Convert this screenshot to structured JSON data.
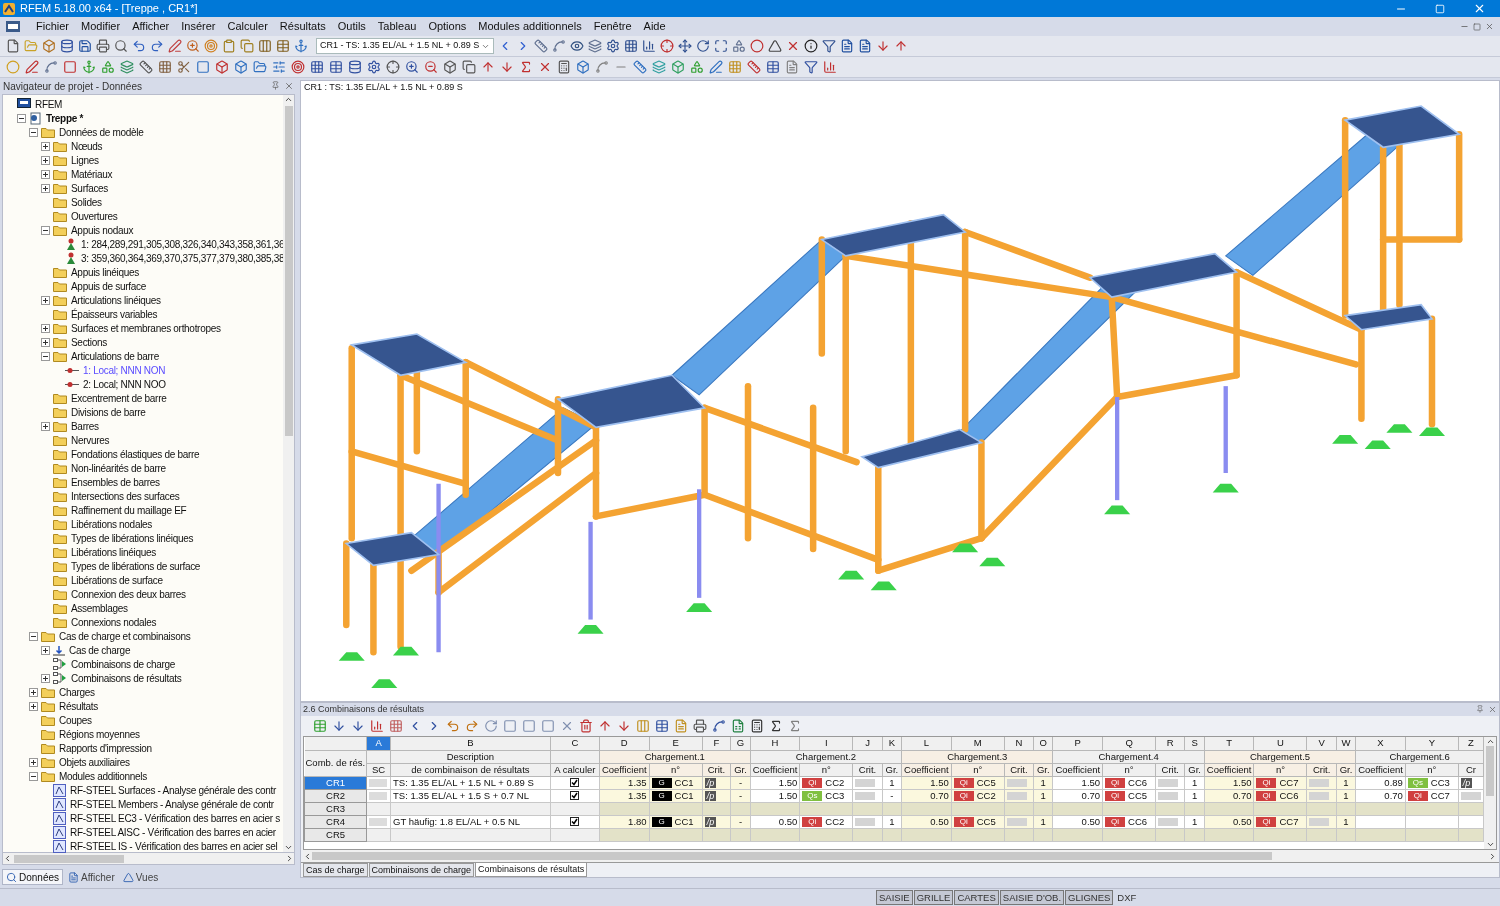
{
  "window": {
    "title": "RFEM 5.18.00 x64 - [Treppe , CR1*]"
  },
  "menu": [
    "Fichier",
    "Modifier",
    "Afficher",
    "Insérer",
    "Calculer",
    "Résultats",
    "Outils",
    "Tableau",
    "Options",
    "Modules additionnels",
    "Fenêtre",
    "Aide"
  ],
  "toolbar": {
    "combo_value": "CR1 - TS: 1.35 EL/AL + 1.5 NL + 0.89 S"
  },
  "navigator": {
    "title": "Navigateur de projet - Données",
    "tree": [
      {
        "label": "RFEM",
        "kind": "root",
        "selected": false,
        "children": [
          {
            "label": "Treppe *",
            "kind": "model",
            "selected": false,
            "expanded": true,
            "children": [
              {
                "label": "Données de modèle",
                "kind": "folder",
                "selected": false,
                "expanded": true,
                "children": [
                  {
                    "label": "Nœuds",
                    "kind": "folder",
                    "selected": false,
                    "expanded": false
                  },
                  {
                    "label": "Lignes",
                    "kind": "folder",
                    "selected": false,
                    "expanded": false
                  },
                  {
                    "label": "Matériaux",
                    "kind": "folder",
                    "selected": false,
                    "expanded": false
                  },
                  {
                    "label": "Surfaces",
                    "kind": "folder",
                    "selected": false,
                    "expanded": false
                  },
                  {
                    "label": "Solides",
                    "kind": "folder",
                    "selected": false
                  },
                  {
                    "label": "Ouvertures",
                    "kind": "folder",
                    "selected": false
                  },
                  {
                    "label": "Appuis nodaux",
                    "kind": "folder",
                    "selected": false,
                    "expanded": true,
                    "children": [
                      {
                        "label": "1: 284,289,291,305,308,326,340,343,358,361,36",
                        "kind": "support",
                        "selected": false
                      },
                      {
                        "label": "3: 359,360,364,369,370,375,377,379,380,385,38",
                        "kind": "support",
                        "selected": false
                      }
                    ]
                  },
                  {
                    "label": "Appuis linéiques",
                    "kind": "folder",
                    "selected": false
                  },
                  {
                    "label": "Appuis de surface",
                    "kind": "folder",
                    "selected": false
                  },
                  {
                    "label": "Articulations linéiques",
                    "kind": "folder",
                    "selected": false,
                    "expanded": false
                  },
                  {
                    "label": "Épaisseurs variables",
                    "kind": "folder",
                    "selected": false
                  },
                  {
                    "label": "Surfaces et membranes orthotropes",
                    "kind": "folder",
                    "selected": false,
                    "expanded": false
                  },
                  {
                    "label": "Sections",
                    "kind": "folder",
                    "selected": false,
                    "expanded": false
                  },
                  {
                    "label": "Articulations de barre",
                    "kind": "folder",
                    "selected": false,
                    "expanded": true,
                    "children": [
                      {
                        "label": "1: Local; NNN NON",
                        "kind": "hinge",
                        "selected": true
                      },
                      {
                        "label": "2: Local; NNN NOO",
                        "kind": "hinge",
                        "selected": false
                      }
                    ]
                  },
                  {
                    "label": "Excentrement de barre",
                    "kind": "folder",
                    "selected": false
                  },
                  {
                    "label": "Divisions de barre",
                    "kind": "folder",
                    "selected": false
                  },
                  {
                    "label": "Barres",
                    "kind": "folder",
                    "selected": false,
                    "expanded": false
                  },
                  {
                    "label": "Nervures",
                    "kind": "folder",
                    "selected": false
                  },
                  {
                    "label": "Fondations élastiques de barre",
                    "kind": "folder",
                    "selected": false
                  },
                  {
                    "label": "Non-linéarités de barre",
                    "kind": "folder",
                    "selected": false
                  },
                  {
                    "label": "Ensembles de barres",
                    "kind": "folder",
                    "selected": false
                  },
                  {
                    "label": "Intersections des surfaces",
                    "kind": "folder",
                    "selected": false
                  },
                  {
                    "label": "Raffinement du maillage EF",
                    "kind": "folder",
                    "selected": false
                  },
                  {
                    "label": "Libérations nodales",
                    "kind": "folder",
                    "selected": false
                  },
                  {
                    "label": "Types de libérations linéiques",
                    "kind": "folder",
                    "selected": false
                  },
                  {
                    "label": "Libérations linéiques",
                    "kind": "folder",
                    "selected": false
                  },
                  {
                    "label": "Types de libérations de surface",
                    "kind": "folder",
                    "selected": false
                  },
                  {
                    "label": "Libérations de surface",
                    "kind": "folder",
                    "selected": false
                  },
                  {
                    "label": "Connexion des deux barres",
                    "kind": "folder",
                    "selected": false
                  },
                  {
                    "label": "Assemblages",
                    "kind": "folder",
                    "selected": false
                  },
                  {
                    "label": "Connexions nodales",
                    "kind": "folder",
                    "selected": false
                  }
                ]
              },
              {
                "label": "Cas de charge et combinaisons",
                "kind": "folder",
                "selected": false,
                "expanded": true,
                "children": [
                  {
                    "label": "Cas de charge",
                    "kind": "load-case",
                    "selected": false,
                    "expanded": false
                  },
                  {
                    "label": "Combinaisons de charge",
                    "kind": "combination",
                    "selected": false
                  },
                  {
                    "label": "Combinaisons de résultats",
                    "kind": "combination",
                    "selected": false,
                    "expanded": false
                  }
                ]
              },
              {
                "label": "Charges",
                "kind": "folder",
                "selected": false,
                "expanded": false
              },
              {
                "label": "Résultats",
                "kind": "folder",
                "selected": false,
                "expanded": false
              },
              {
                "label": "Coupes",
                "kind": "folder",
                "selected": false
              },
              {
                "label": "Régions moyennes",
                "kind": "folder",
                "selected": false
              },
              {
                "label": "Rapports d'impression",
                "kind": "folder",
                "selected": false
              },
              {
                "label": "Objets auxiliaires",
                "kind": "folder",
                "selected": false,
                "expanded": false
              },
              {
                "label": "Modules additionnels",
                "kind": "folder",
                "selected": false,
                "expanded": true,
                "children": [
                  {
                    "label": "RF-STEEL Surfaces - Analyse générale des contr",
                    "kind": "module",
                    "selected": false
                  },
                  {
                    "label": "RF-STEEL Members - Analyse générale de contr",
                    "kind": "module",
                    "selected": false
                  },
                  {
                    "label": "RF-STEEL EC3 - Vérification des barres en acier s",
                    "kind": "module",
                    "selected": false
                  },
                  {
                    "label": "RF-STEEL AISC - Vérification des barres en acier",
                    "kind": "module",
                    "selected": false
                  },
                  {
                    "label": "RF-STEEL IS - Vérification des barres en acier sel",
                    "kind": "module",
                    "selected": false
                  }
                ]
              }
            ]
          }
        ]
      }
    ],
    "tabs": [
      {
        "label": "Données",
        "selected": true
      },
      {
        "label": "Afficher",
        "selected": false
      },
      {
        "label": "Vues",
        "selected": false
      }
    ]
  },
  "view": {
    "caption": "CR1 : TS: 1.35 EL/AL + 1.5 NL + 0.89 S"
  },
  "table": {
    "title": "2.6 Combinaisons de résultats",
    "columns": [
      {
        "letter": "A",
        "selected": true
      },
      {
        "letter": "B",
        "selected": false
      },
      {
        "letter": "C",
        "selected": false
      },
      {
        "letter": "D",
        "selected": false
      },
      {
        "letter": "E",
        "selected": false
      },
      {
        "letter": "F",
        "selected": false
      },
      {
        "letter": "G",
        "selected": false
      },
      {
        "letter": "H",
        "selected": false
      },
      {
        "letter": "I",
        "selected": false
      },
      {
        "letter": "J",
        "selected": false
      },
      {
        "letter": "K",
        "selected": false
      },
      {
        "letter": "L",
        "selected": false
      },
      {
        "letter": "M",
        "selected": false
      },
      {
        "letter": "N",
        "selected": false
      },
      {
        "letter": "O",
        "selected": false
      },
      {
        "letter": "P",
        "selected": false
      },
      {
        "letter": "Q",
        "selected": false
      },
      {
        "letter": "R",
        "selected": false
      },
      {
        "letter": "S",
        "selected": false
      },
      {
        "letter": "T",
        "selected": false
      },
      {
        "letter": "U",
        "selected": false
      },
      {
        "letter": "V",
        "selected": false
      },
      {
        "letter": "W",
        "selected": false
      },
      {
        "letter": "X",
        "selected": false
      },
      {
        "letter": "Y",
        "selected": false
      },
      {
        "letter": "Z",
        "selected": false
      }
    ],
    "row_header_title": "Comb. de rés.",
    "sc_header": "SC",
    "description_header": "Description",
    "description_subheader": "de combinaison de résultats",
    "calculate_header": "A calculer",
    "load_groups": [
      {
        "title": "Chargement.1",
        "headers": [
          "Coefficient",
          "n°",
          "Crit.",
          "Gr."
        ]
      },
      {
        "title": "Chargement.2",
        "headers": [
          "Coefficient",
          "n°",
          "Crit.",
          "Gr."
        ]
      },
      {
        "title": "Chargement.3",
        "headers": [
          "Coefficient",
          "n°",
          "Crit.",
          "Gr."
        ]
      },
      {
        "title": "Chargement.4",
        "headers": [
          "Coefficient",
          "n°",
          "Crit.",
          "Gr."
        ]
      },
      {
        "title": "Chargement.5",
        "headers": [
          "Coefficient",
          "n°",
          "Crit.",
          "Gr."
        ]
      },
      {
        "title": "Chargement.6",
        "headers": [
          "Coefficient",
          "n°",
          "Cr"
        ]
      }
    ],
    "rows": [
      {
        "id": "CR1",
        "selected": true,
        "kind": "combination",
        "description": "TS: 1.35 EL/AL + 1.5 NL + 0.89 S",
        "calculate": true,
        "loads": [
          {
            "coefficient": "1.35",
            "action": "G",
            "color": "#000000",
            "case": "CC1",
            "criterion": "/p",
            "group": "-"
          },
          {
            "coefficient": "1.50",
            "action": "Qi",
            "color": "#d04040",
            "case": "CC2",
            "group": "1"
          },
          {
            "coefficient": "1.50",
            "action": "Qi",
            "color": "#d04040",
            "case": "CC5",
            "group": "1"
          },
          {
            "coefficient": "1.50",
            "action": "Qi",
            "color": "#d04040",
            "case": "CC6",
            "group": "1"
          },
          {
            "coefficient": "1.50",
            "action": "Qi",
            "color": "#d04040",
            "case": "CC7",
            "group": "1"
          },
          {
            "coefficient": "0.89",
            "action": "Qs",
            "color": "#80c040",
            "case": "CC3",
            "criterion": "/p"
          }
        ]
      },
      {
        "id": "CR2",
        "selected": false,
        "kind": "combination",
        "description": "TS: 1.35 EL/AL + 1.5 S + 0.7 NL",
        "calculate": true,
        "loads": [
          {
            "coefficient": "1.35",
            "action": "G",
            "color": "#000000",
            "case": "CC1",
            "criterion": "/p",
            "group": "-"
          },
          {
            "coefficient": "1.50",
            "action": "Qs",
            "color": "#80c040",
            "case": "CC3",
            "group": "-"
          },
          {
            "coefficient": "0.70",
            "action": "Qi",
            "color": "#d04040",
            "case": "CC2",
            "group": "1"
          },
          {
            "coefficient": "0.70",
            "action": "Qi",
            "color": "#d04040",
            "case": "CC5",
            "group": "1"
          },
          {
            "coefficient": "0.70",
            "action": "Qi",
            "color": "#d04040",
            "case": "CC6",
            "group": "1"
          },
          {
            "coefficient": "0.70",
            "action": "Qi",
            "color": "#d04040",
            "case": "CC7"
          }
        ]
      },
      {
        "id": "CR3",
        "selected": false,
        "kind": "empty"
      },
      {
        "id": "CR4",
        "selected": false,
        "kind": "combination",
        "description": "GT häufig: 1.8 EL/AL + 0.5 NL",
        "calculate": true,
        "loads": [
          {
            "coefficient": "1.80",
            "action": "G",
            "color": "#000000",
            "case": "CC1",
            "criterion": "/p",
            "group": "-"
          },
          {
            "coefficient": "0.50",
            "action": "Qi",
            "color": "#d04040",
            "case": "CC2",
            "group": "1"
          },
          {
            "coefficient": "0.50",
            "action": "Qi",
            "color": "#d04040",
            "case": "CC5",
            "group": "1"
          },
          {
            "coefficient": "0.50",
            "action": "Qi",
            "color": "#d04040",
            "case": "CC6",
            "group": "1"
          },
          {
            "coefficient": "0.50",
            "action": "Qi",
            "color": "#d04040",
            "case": "CC7",
            "group": "1"
          }
        ]
      },
      {
        "id": "CR5",
        "selected": false,
        "kind": "empty"
      }
    ],
    "sheet_tabs": [
      {
        "label": "Cas de charge",
        "selected": false
      },
      {
        "label": "Combinaisons de charge",
        "selected": false
      },
      {
        "label": "Combinaisons de résultats",
        "selected": true
      }
    ]
  },
  "status_bar": {
    "buttons": [
      {
        "label": "SAISIE",
        "on": true
      },
      {
        "label": "GRILLE",
        "on": true
      },
      {
        "label": "CARTES",
        "on": true
      },
      {
        "label": "SAISIE D'OB.",
        "on": true
      },
      {
        "label": "GLIGNES",
        "on": true
      },
      {
        "label": "DXF",
        "on": false
      }
    ]
  }
}
